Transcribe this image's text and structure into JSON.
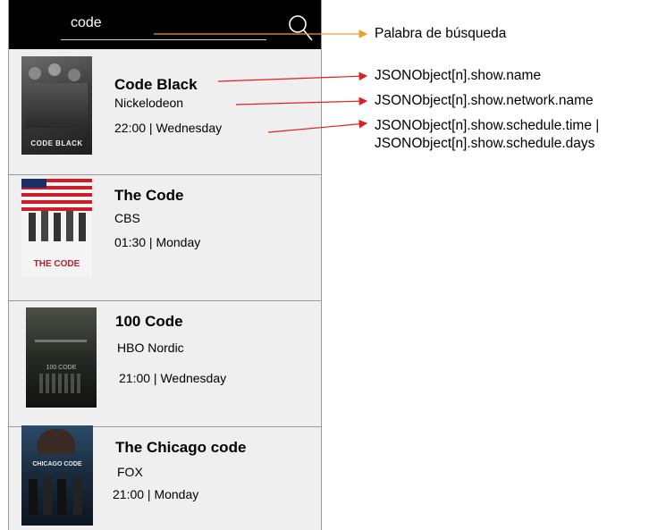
{
  "search": {
    "query": "code"
  },
  "results": [
    {
      "title": "Code Black",
      "network": "Nickelodeon",
      "schedule": "22:00 | Wednesday",
      "poster_text": "CODE BLACK"
    },
    {
      "title": "The Code",
      "network": "CBS",
      "schedule": "01:30 | Monday",
      "poster_text": "THE CODE"
    },
    {
      "title": "100 Code",
      "network": "HBO Nordic",
      "schedule": "21:00 | Wednesday",
      "poster_text": "100 CODE"
    },
    {
      "title": "The Chicago code",
      "network": "FOX",
      "schedule": "21:00 | Monday",
      "poster_text": "CHICAGO CODE"
    }
  ],
  "annotations": {
    "search_word": "Palabra de búsqueda",
    "show_name": "JSONObject[n].show.name",
    "network_name": "JSONObject[n].show.network.name",
    "schedule_line1": "JSONObject[n].show.schedule.time |",
    "schedule_line2": "JSONObject[n].show.schedule.days"
  },
  "colors": {
    "search_arrow": "#f0a020",
    "field_arrow": "#e02020"
  }
}
